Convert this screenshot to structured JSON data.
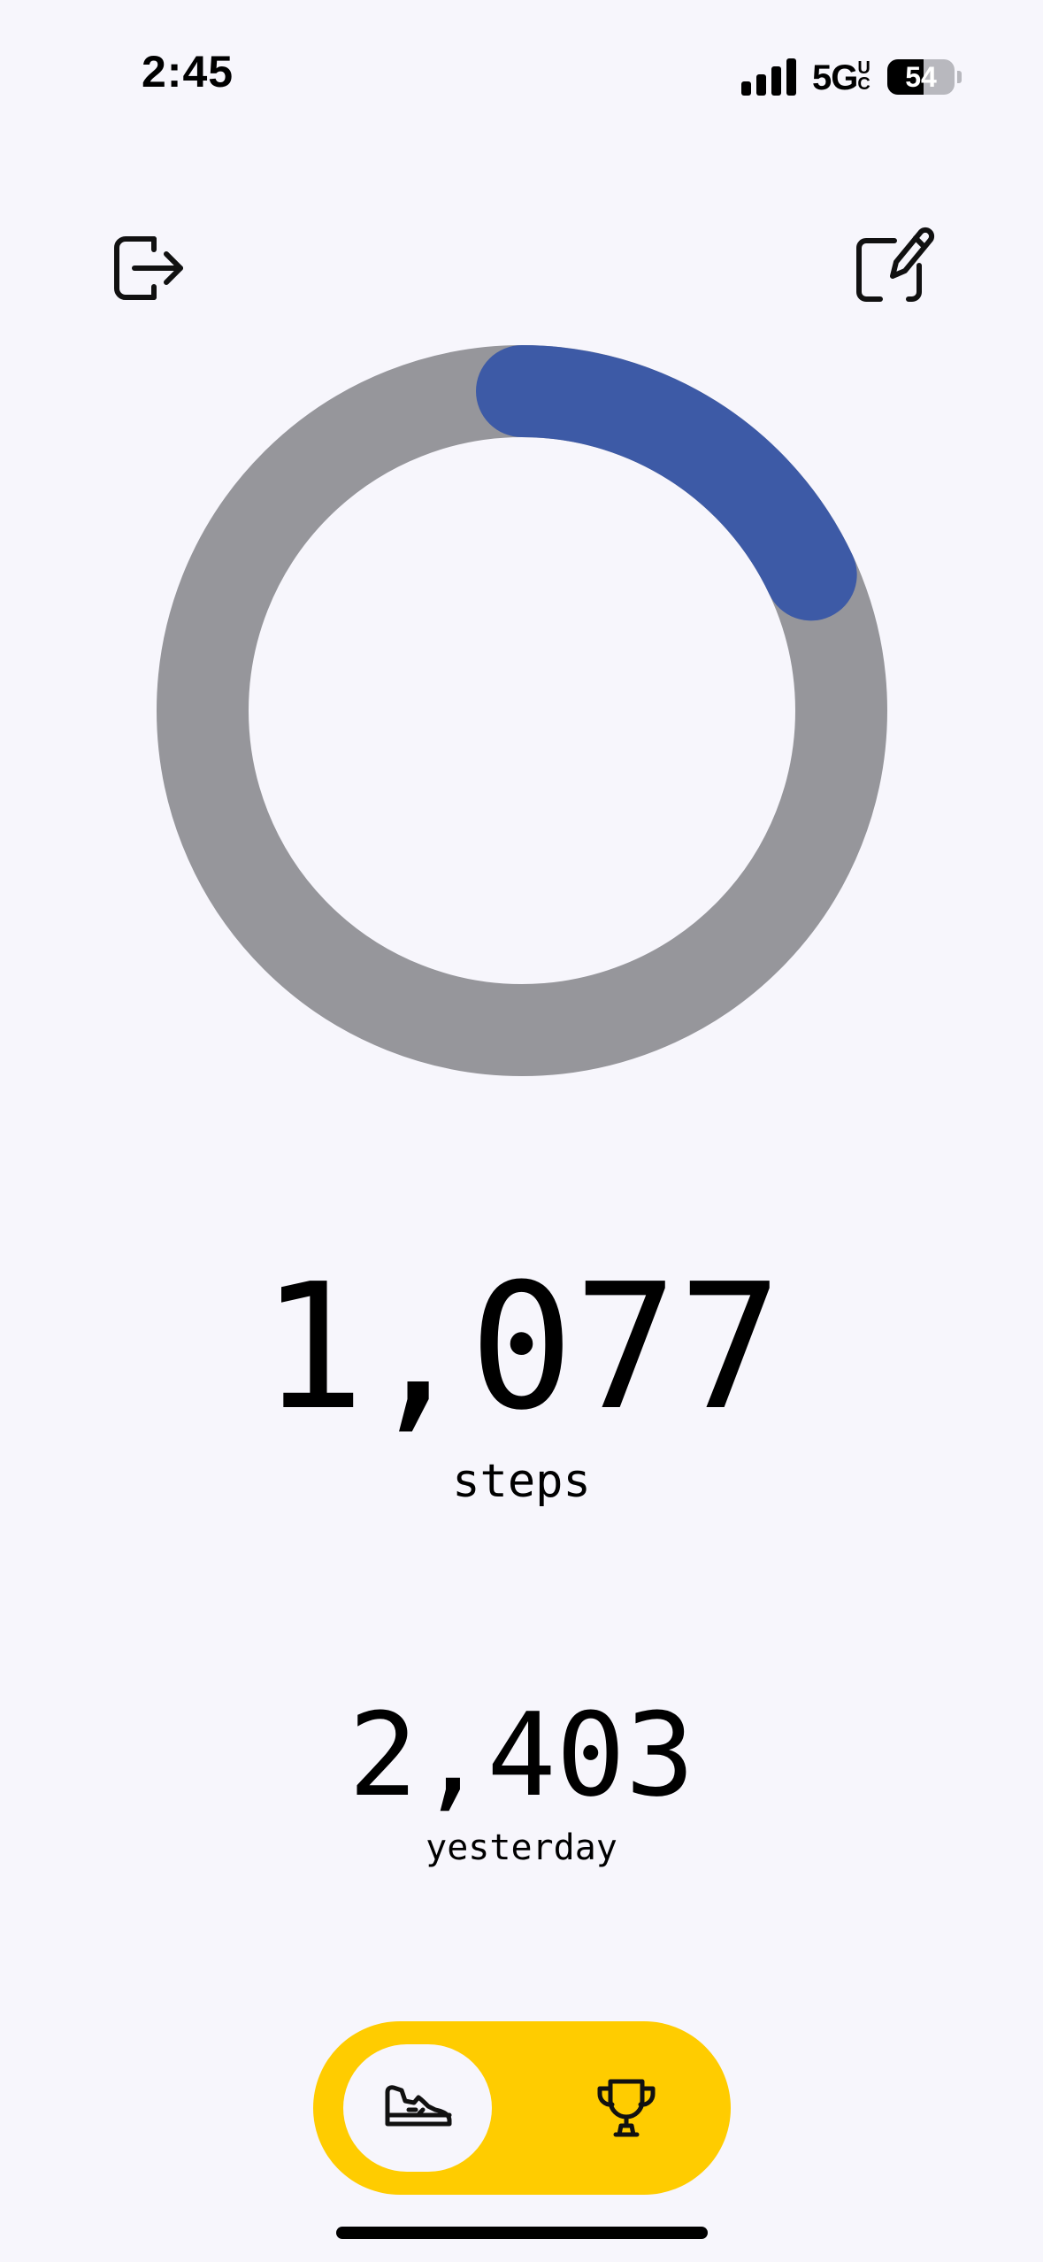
{
  "status_bar": {
    "time": "2:45",
    "network": "5G",
    "network_badge": "UC",
    "battery": "54",
    "battery_level": 0.54
  },
  "header": {
    "left_icon": "logout-icon",
    "right_icon": "edit-icon"
  },
  "progress": {
    "fraction": 0.18,
    "track_color": "#96969B",
    "fill_color": "#3D5AA6"
  },
  "steps": {
    "today": "1,077",
    "today_label": "steps",
    "yesterday": "2,403",
    "yesterday_label": "yesterday"
  },
  "tabbar": {
    "accent": "#FFCC00",
    "tabs": [
      {
        "icon": "sneaker-icon",
        "selected": true
      },
      {
        "icon": "trophy-icon",
        "selected": false
      }
    ]
  }
}
